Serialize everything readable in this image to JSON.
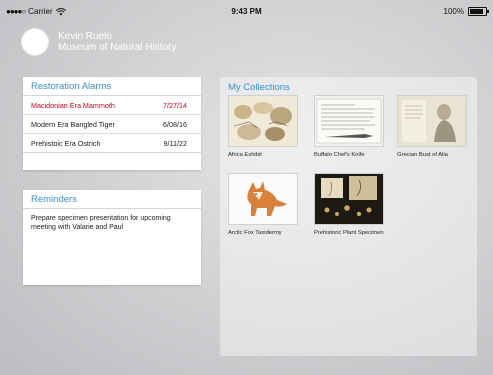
{
  "status_bar": {
    "carrier": "Carrier",
    "time": "9:43 PM",
    "battery": "100%"
  },
  "profile": {
    "name": "Kevin Ruelo",
    "organization": "Museum of Natural History"
  },
  "alarms": {
    "title": "Restoration Alarms",
    "items": [
      {
        "name": "Macidonian Era Mammoth",
        "date": "7/27/14"
      },
      {
        "name": "Modern Era Bangled Tiger",
        "date": "6/08/16"
      },
      {
        "name": "Prehistoic Era Ostrich",
        "date": "9/11/22"
      }
    ],
    "alert_color": "#d0021b"
  },
  "reminders": {
    "title": "Reminders",
    "text": "Prepare specimen presentation for upcoming meeting with Valarie and Paul"
  },
  "collections": {
    "title": "My Collections",
    "items": [
      {
        "label": "Africa Exhibit",
        "icon": "sketch-collage-thumbnail"
      },
      {
        "label": "Buffalo Chef's Knife",
        "icon": "document-photo-thumbnail"
      },
      {
        "label": "Grecian Bust of Alia",
        "icon": "statue-sketch-thumbnail"
      },
      {
        "label": "Arctic Fox Taxidermy",
        "icon": "fox-photo-thumbnail"
      },
      {
        "label": "Prehistoric Plant Specimen",
        "icon": "plant-specimen-thumbnail"
      }
    ]
  },
  "colors": {
    "accent": "#3d8fd6",
    "card_background": "#ffffff"
  }
}
